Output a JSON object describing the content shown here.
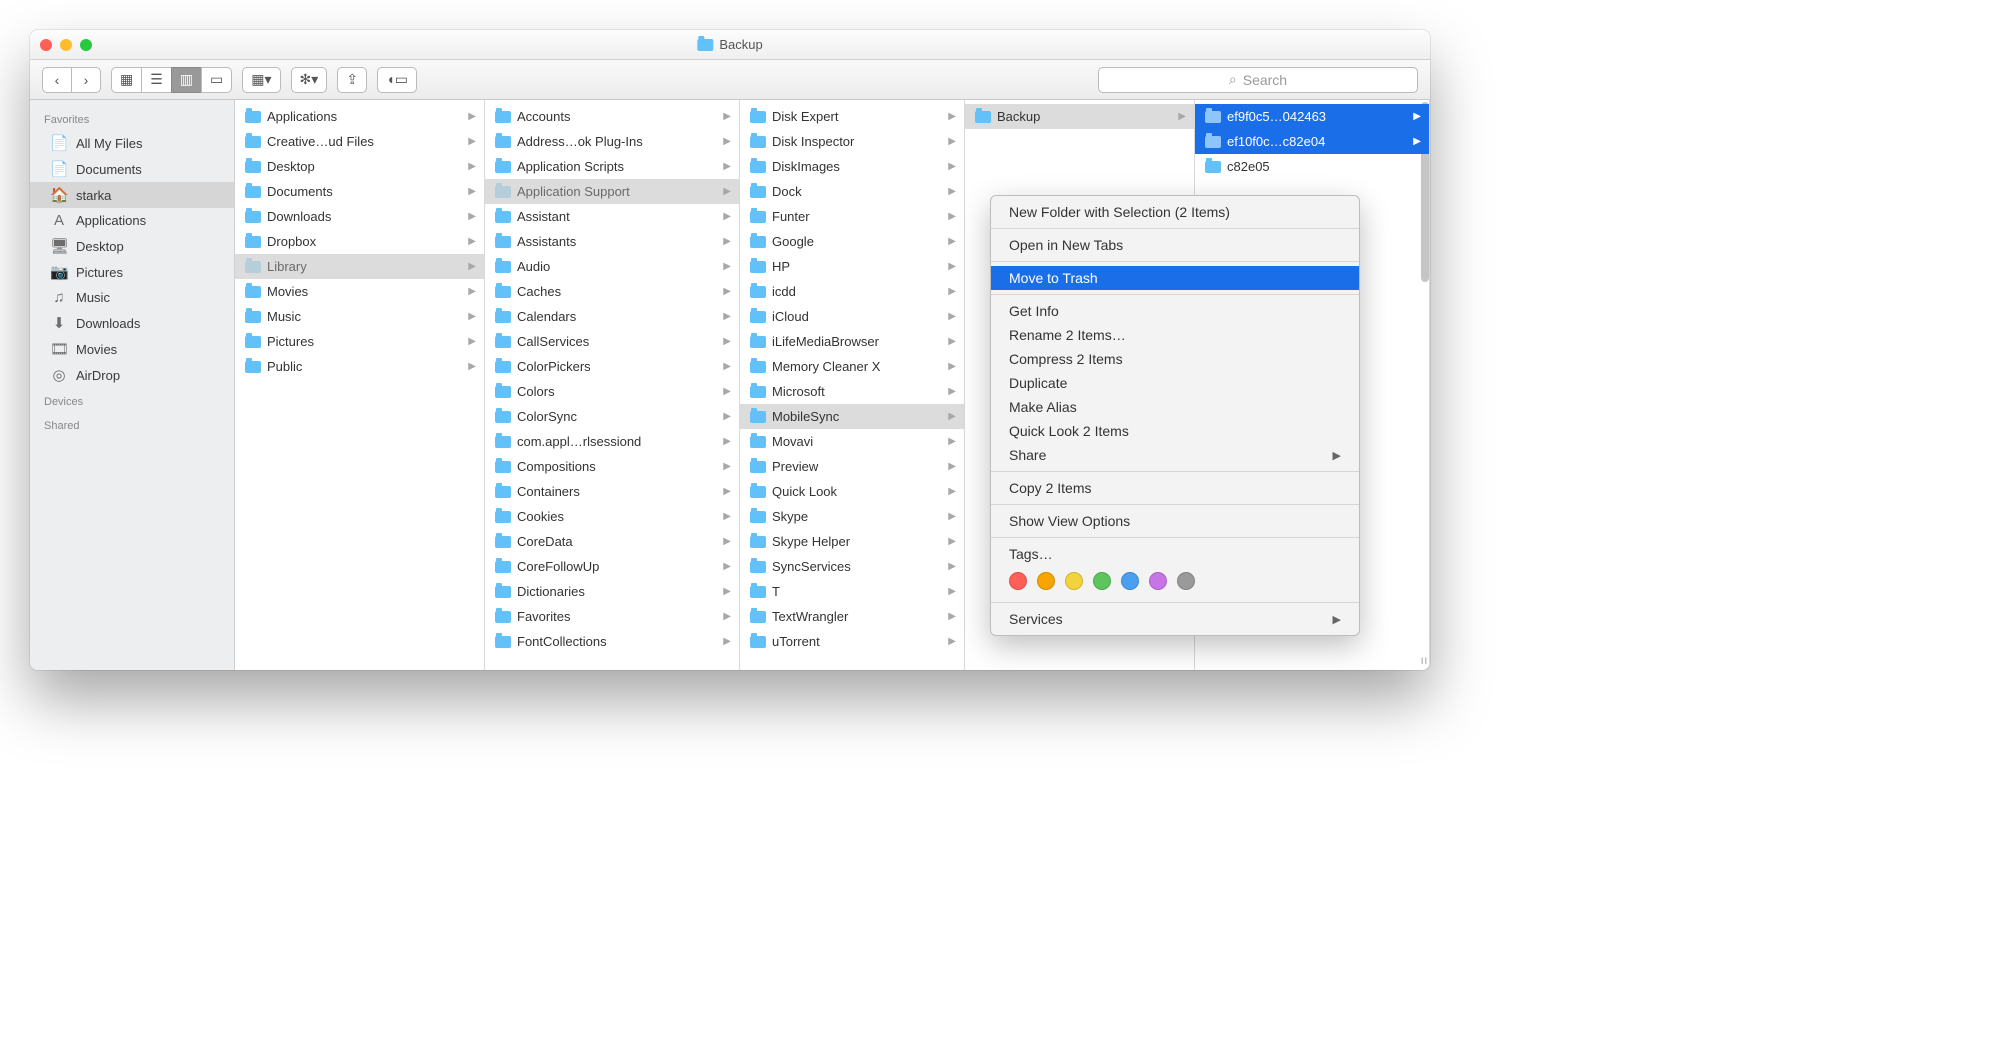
{
  "window_title": "Backup",
  "search_placeholder": "Search",
  "sidebar": {
    "sections": {
      "favorites": "Favorites",
      "devices": "Devices",
      "shared": "Shared"
    },
    "items": [
      {
        "icon": "📄",
        "label": "All My Files"
      },
      {
        "icon": "📄",
        "label": "Documents"
      },
      {
        "icon": "🏠",
        "label": "starka",
        "selected": true
      },
      {
        "icon": "A",
        "label": "Applications"
      },
      {
        "icon": "🖥",
        "label": "Desktop"
      },
      {
        "icon": "📷",
        "label": "Pictures"
      },
      {
        "icon": "♫",
        "label": "Music"
      },
      {
        "icon": "⬇",
        "label": "Downloads"
      },
      {
        "icon": "🎞",
        "label": "Movies"
      },
      {
        "icon": "◎",
        "label": "AirDrop"
      }
    ]
  },
  "columns": {
    "c1": [
      {
        "label": "Applications"
      },
      {
        "label": "Creative…ud Files"
      },
      {
        "label": "Desktop"
      },
      {
        "label": "Documents"
      },
      {
        "label": "Downloads"
      },
      {
        "label": "Dropbox"
      },
      {
        "label": "Library",
        "path": true
      },
      {
        "label": "Movies"
      },
      {
        "label": "Music"
      },
      {
        "label": "Pictures"
      },
      {
        "label": "Public"
      }
    ],
    "c2": [
      {
        "label": "Accounts"
      },
      {
        "label": "Address…ok Plug-Ins"
      },
      {
        "label": "Application Scripts"
      },
      {
        "label": "Application Support",
        "path": true
      },
      {
        "label": "Assistant"
      },
      {
        "label": "Assistants"
      },
      {
        "label": "Audio"
      },
      {
        "label": "Caches"
      },
      {
        "label": "Calendars"
      },
      {
        "label": "CallServices"
      },
      {
        "label": "ColorPickers"
      },
      {
        "label": "Colors"
      },
      {
        "label": "ColorSync"
      },
      {
        "label": "com.appl…rlsessiond"
      },
      {
        "label": "Compositions"
      },
      {
        "label": "Containers"
      },
      {
        "label": "Cookies"
      },
      {
        "label": "CoreData"
      },
      {
        "label": "CoreFollowUp"
      },
      {
        "label": "Dictionaries"
      },
      {
        "label": "Favorites"
      },
      {
        "label": "FontCollections"
      }
    ],
    "c3": [
      {
        "label": "Disk Expert"
      },
      {
        "label": "Disk Inspector"
      },
      {
        "label": "DiskImages"
      },
      {
        "label": "Dock"
      },
      {
        "label": "Funter"
      },
      {
        "label": "Google"
      },
      {
        "label": "HP"
      },
      {
        "label": "icdd"
      },
      {
        "label": "iCloud"
      },
      {
        "label": "iLifeMediaBrowser"
      },
      {
        "label": "Memory Cleaner X"
      },
      {
        "label": "Microsoft"
      },
      {
        "label": "MobileSync",
        "sel": true
      },
      {
        "label": "Movavi"
      },
      {
        "label": "Preview"
      },
      {
        "label": "Quick Look"
      },
      {
        "label": "Skype"
      },
      {
        "label": "Skype Helper"
      },
      {
        "label": "SyncServices"
      },
      {
        "label": "T"
      },
      {
        "label": "TextWrangler"
      },
      {
        "label": "uTorrent"
      }
    ],
    "c4": [
      {
        "label": "Backup",
        "sel": true
      }
    ],
    "c5": [
      {
        "label": "ef9f0c5…042463",
        "selblue": true
      },
      {
        "label": "ef10f0c…c82e04",
        "selblue": true
      },
      {
        "label": "c82e05",
        "plain": true
      }
    ]
  },
  "context_menu": {
    "items": [
      {
        "label": "New Folder with Selection (2 Items)"
      },
      {
        "sep": true
      },
      {
        "label": "Open in New Tabs"
      },
      {
        "sep": true
      },
      {
        "label": "Move to Trash",
        "highlight": true
      },
      {
        "sep": true
      },
      {
        "label": "Get Info"
      },
      {
        "label": "Rename 2 Items…"
      },
      {
        "label": "Compress 2 Items"
      },
      {
        "label": "Duplicate"
      },
      {
        "label": "Make Alias"
      },
      {
        "label": "Quick Look 2 Items"
      },
      {
        "label": "Share",
        "sub": true
      },
      {
        "sep": true
      },
      {
        "label": "Copy 2 Items"
      },
      {
        "sep": true
      },
      {
        "label": "Show View Options"
      },
      {
        "sep": true
      },
      {
        "label": "Tags…"
      },
      {
        "tags": true
      },
      {
        "sep": true
      },
      {
        "label": "Services",
        "sub": true
      }
    ],
    "tag_colors": [
      "#ff5f57",
      "#f7a500",
      "#f3d33b",
      "#5ec45e",
      "#4a9ff0",
      "#c774e6",
      "#9a9a9a"
    ]
  }
}
